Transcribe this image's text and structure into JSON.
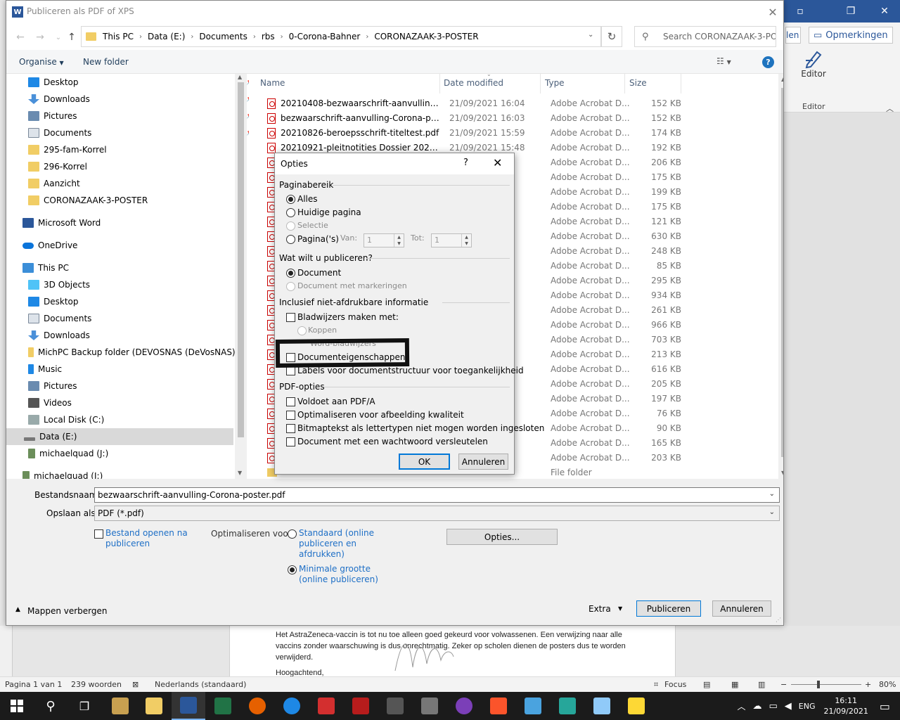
{
  "word": {
    "share_label": "len",
    "comments_label": "Opmerkingen",
    "editor_label": "Editor",
    "editor_group_label": "Editor",
    "document_lines": [
      "Het AstraZeneca-vaccin is tot nu toe alleen goed gekeurd voor volwassenen. Een verwijzing naar alle",
      "vaccins zonder waarschuwing is dus onrechtmatig. Zeker op scholen dienen de posters dus te worden",
      "verwijderd.",
      "Hoogachtend,"
    ],
    "statusbar": {
      "page": "Pagina 1 van 1",
      "words": "239 woorden",
      "language": "Nederlands (standaard)",
      "focus": "Focus",
      "zoom": "80%"
    }
  },
  "dialog": {
    "title": "Publiceren als PDF of XPS",
    "breadcrumb": [
      "This PC",
      "Data (E:)",
      "Documents",
      "rbs",
      "0-Corona-Bahner",
      "CORONAZAAK-3-POSTER"
    ],
    "search_placeholder": "Search CORONAZAAK-3-PO...",
    "toolbar": {
      "organise": "Organise",
      "new_folder": "New folder"
    },
    "nav": {
      "desktop": "Desktop",
      "downloads": "Downloads",
      "pictures": "Pictures",
      "documents": "Documents",
      "f295": "295-fam-Korrel",
      "f296": "296-Korrel",
      "aanzicht": "Aanzicht",
      "corona": "CORONAZAAK-3-POSTER",
      "word": "Microsoft Word",
      "onedrive": "OneDrive",
      "thispc": "This PC",
      "objects3d": "3D Objects",
      "desktop2": "Desktop",
      "documents2": "Documents",
      "downloads2": "Downloads",
      "michpc": "MichPC Backup folder (DEVOSNAS (DeVosNAS))",
      "music": "Music",
      "pictures2": "Pictures",
      "videos": "Videos",
      "localc": "Local Disk (C:)",
      "datae": "Data (E:)",
      "mqj": "michaelquad (J:)",
      "mqj2": "michaelquad (J:)"
    },
    "columns": {
      "name": "Name",
      "date": "Date modified",
      "type": "Type",
      "size": "Size"
    },
    "files": [
      {
        "name": "20210408-bezwaarschrift-aanvulling-Cor...",
        "date": "21/09/2021 16:04",
        "type": "Adobe Acrobat D...",
        "size": "152 KB"
      },
      {
        "name": "bezwaarschrift-aanvulling-Corona-poste...",
        "date": "21/09/2021 16:03",
        "type": "Adobe Acrobat D...",
        "size": "152 KB"
      },
      {
        "name": "20210826-beroepsschrift-titeltest.pdf",
        "date": "21/09/2021 15:59",
        "type": "Adobe Acrobat D...",
        "size": "174 KB"
      },
      {
        "name": "20210921-pleitnotities Dossier 2021000701...",
        "date": "21/09/2021 15:48",
        "type": "Adobe Acrobat D...",
        "size": "192 KB"
      },
      {
        "name": "",
        "date": "",
        "type": "Adobe Acrobat D...",
        "size": "206 KB"
      },
      {
        "name": "",
        "date": "",
        "type": "Adobe Acrobat D...",
        "size": "175 KB"
      },
      {
        "name": "",
        "date": "",
        "type": "Adobe Acrobat D...",
        "size": "199 KB"
      },
      {
        "name": "",
        "date": "",
        "type": "Adobe Acrobat D...",
        "size": "175 KB"
      },
      {
        "name": "",
        "date": "",
        "type": "Adobe Acrobat D...",
        "size": "121 KB"
      },
      {
        "name": "",
        "date": "",
        "type": "Adobe Acrobat D...",
        "size": "630 KB"
      },
      {
        "name": "",
        "date": "",
        "type": "Adobe Acrobat D...",
        "size": "248 KB"
      },
      {
        "name": "",
        "date": "",
        "type": "Adobe Acrobat D...",
        "size": "85 KB"
      },
      {
        "name": "",
        "date": "",
        "type": "Adobe Acrobat D...",
        "size": "295 KB"
      },
      {
        "name": "",
        "date": "",
        "type": "Adobe Acrobat D...",
        "size": "934 KB"
      },
      {
        "name": "",
        "date": "",
        "type": "Adobe Acrobat D...",
        "size": "261 KB"
      },
      {
        "name": "",
        "date": "",
        "type": "Adobe Acrobat D...",
        "size": "966 KB"
      },
      {
        "name": "",
        "date": "",
        "type": "Adobe Acrobat D...",
        "size": "703 KB"
      },
      {
        "name": "",
        "date": "",
        "type": "Adobe Acrobat D...",
        "size": "213 KB"
      },
      {
        "name": "",
        "date": "",
        "type": "Adobe Acrobat D...",
        "size": "616 KB"
      },
      {
        "name": "",
        "date": "",
        "type": "Adobe Acrobat D...",
        "size": "205 KB"
      },
      {
        "name": "",
        "date": "",
        "type": "Adobe Acrobat D...",
        "size": "197 KB"
      },
      {
        "name": "",
        "date": "",
        "type": "Adobe Acrobat D...",
        "size": "76 KB"
      },
      {
        "name": "",
        "date": "",
        "type": "Adobe Acrobat D...",
        "size": "90 KB"
      },
      {
        "name": "",
        "date": "",
        "type": "Adobe Acrobat D...",
        "size": "165 KB"
      },
      {
        "name": "",
        "date": "",
        "type": "Adobe Acrobat D...",
        "size": "203 KB"
      },
      {
        "name": "",
        "date": "",
        "type": "File folder",
        "size": ""
      }
    ],
    "filename_label": "Bestandsnaam:",
    "filename_value": "bezwaarschrift-aanvulling-Corona-poster.pdf",
    "savetype_label": "Opslaan als:",
    "savetype_value": "PDF (*.pdf)",
    "open_after_line1": "Bestand openen na",
    "open_after_line2": "publiceren",
    "optimize_label": "Optimaliseren voor:",
    "opt_standard": [
      "Standaard (online",
      "publiceren en",
      "afdrukken)"
    ],
    "opt_minimal": [
      "Minimale grootte",
      "(online publiceren)"
    ],
    "options_button": "Opties...",
    "hide_folders": "Mappen verbergen",
    "extra": "Extra",
    "publish": "Publiceren",
    "cancel": "Annuleren"
  },
  "options_dialog": {
    "title": "Opties",
    "help": "?",
    "sec_range": "Paginabereik",
    "all": "Alles",
    "current": "Huidige pagina",
    "selection": "Selectie",
    "pages": "Pagina('s)",
    "from_label": "Van:",
    "from_value": "1",
    "to_label": "Tot:",
    "to_value": "1",
    "sec_what": "Wat wilt u publiceren?",
    "document": "Document",
    "doc_markup": "Document met markeringen",
    "sec_nonprint": "Inclusief niet-afdrukbare informatie",
    "bookmarks": "Bladwijzers maken met:",
    "headings": "Koppen",
    "word_bookmarks": "Word-bladwijzers",
    "doc_props": "Documenteigenschappen",
    "struct_tags": "Labels voor documentstructuur voor toegankelijkheid",
    "sec_pdf": "PDF-opties",
    "pdfa": "Voldoet aan PDF/A",
    "optimize_img": "Optimaliseren voor afbeelding kwaliteit",
    "bitmap": "Bitmaptekst als lettertypen niet mogen worden ingesloten",
    "encrypt": "Document met een wachtwoord versleutelen",
    "ok": "OK",
    "cancel": "Annuleren"
  },
  "taskbar": {
    "language": "ENG",
    "time": "16:11",
    "date": "21/09/2021"
  }
}
